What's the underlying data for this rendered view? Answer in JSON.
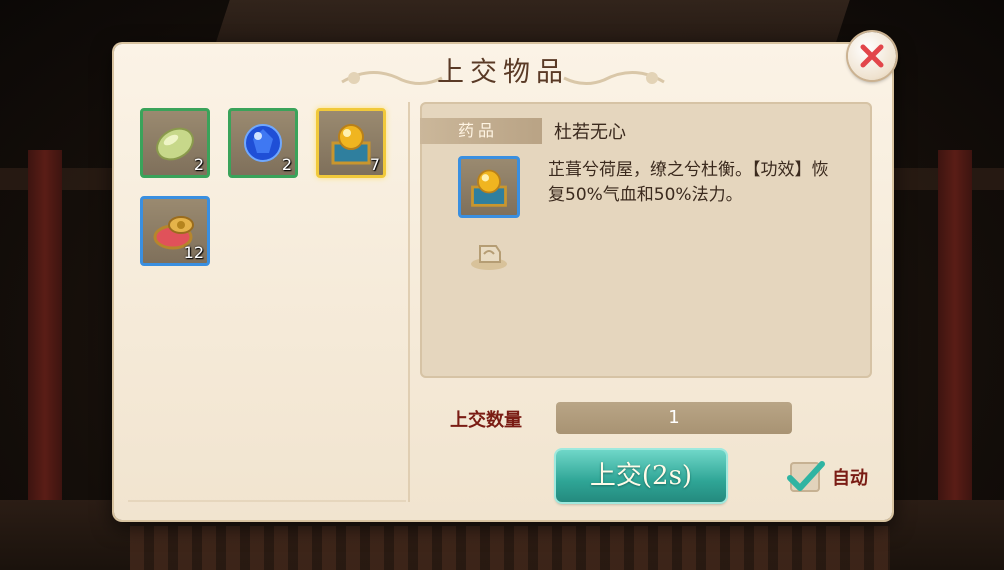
{
  "dialog": {
    "title": "上交物品",
    "close_icon": "close-icon"
  },
  "inventory": [
    {
      "name": "green-gem-icon",
      "count": "2",
      "rarity_color": "#3aa35a"
    },
    {
      "name": "blue-sapphire-icon",
      "count": "2",
      "rarity_color": "#3aa35a"
    },
    {
      "name": "golden-orb-chest-icon",
      "count": "7",
      "rarity_color": "#f1c93a"
    },
    {
      "name": "red-medicine-box-icon",
      "count": "12",
      "rarity_color": "#3a8fe0"
    }
  ],
  "detail": {
    "category": "药品",
    "item_name": "杜若无心",
    "description": "芷葺兮荷屋，缭之兮杜衡。【功效】恢复50%气血和50%法力。"
  },
  "quantity": {
    "label": "上交数量",
    "value": "1"
  },
  "submit_label": "上交(2s)",
  "auto": {
    "label": "自动",
    "checked": true
  },
  "colors": {
    "accent_teal": "#2fa596",
    "label_red": "#7a1c14"
  }
}
